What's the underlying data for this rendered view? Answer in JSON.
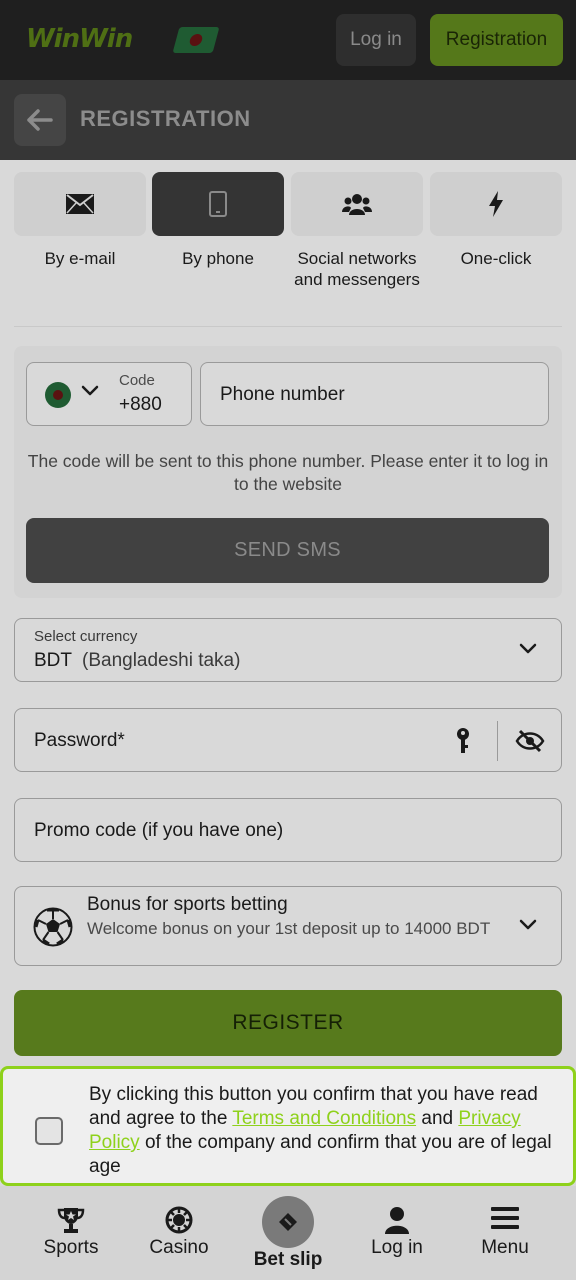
{
  "header": {
    "logo_text": "WinWin",
    "login_label": "Log in",
    "registration_label": "Registration"
  },
  "title_bar": {
    "title": "REGISTRATION"
  },
  "tabs": [
    {
      "label": "By e-mail",
      "icon": "envelope-icon",
      "active": false
    },
    {
      "label": "By phone",
      "icon": "smartphone-icon",
      "active": true
    },
    {
      "label": "Social networks and messengers",
      "icon": "users-icon",
      "active": false
    },
    {
      "label": "One-click",
      "icon": "lightning-icon",
      "active": false
    }
  ],
  "phone": {
    "code_label": "Code",
    "code_value": "+880",
    "phone_placeholder": "Phone number",
    "hint": "The code will be sent to this phone number. Please enter it to log in to the website",
    "send_sms_label": "SEND SMS"
  },
  "currency": {
    "label": "Select currency",
    "code": "BDT",
    "name": "(Bangladeshi taka)"
  },
  "password": {
    "placeholder": "Password*"
  },
  "promo": {
    "placeholder": "Promo code (if you have one)"
  },
  "bonus": {
    "title": "Bonus for sports betting",
    "description": "Welcome bonus on your 1st deposit up to 14000 BDT"
  },
  "register_label": "REGISTER",
  "consent": {
    "text_1": "By clicking this button you confirm that you have read and agree to the ",
    "terms_link": "Terms and Conditions",
    "text_2": " and ",
    "privacy_link": "Privacy Policy",
    "text_3": " of the company and confirm that you are of legal age",
    "checked": false
  },
  "bottom_nav": {
    "sports": "Sports",
    "casino": "Casino",
    "bet_slip": "Bet slip",
    "login": "Log in",
    "menu": "Menu"
  },
  "colors": {
    "accent_green": "#8ed11b",
    "button_green_dimmed": "#577a1c",
    "header_dark": "#1f1f1f"
  }
}
